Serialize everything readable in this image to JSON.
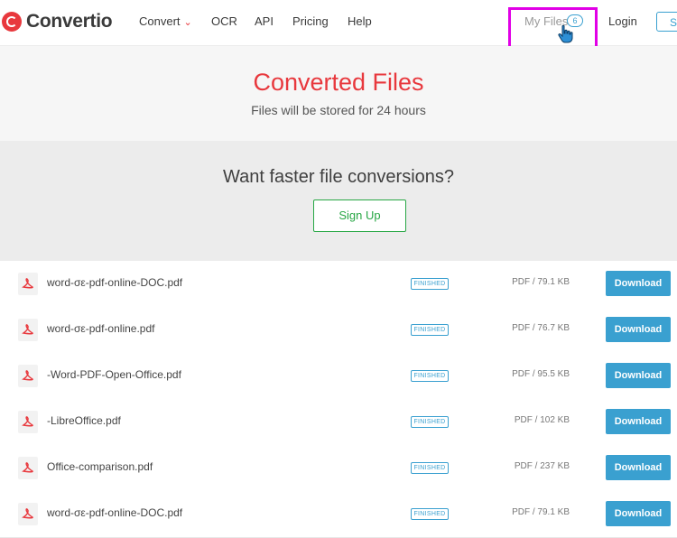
{
  "header": {
    "logo_text": "Convertio",
    "nav": {
      "convert": "Convert",
      "ocr": "OCR",
      "api": "API",
      "pricing": "Pricing",
      "help": "Help",
      "my_files": "My Files",
      "my_files_count": "6",
      "login": "Login",
      "signup": "S"
    }
  },
  "hero": {
    "title": "Converted Files",
    "subtitle": "Files will be stored for 24 hours"
  },
  "promo": {
    "title": "Want faster file conversions?",
    "button": "Sign Up"
  },
  "files": [
    {
      "name": "word-σε-pdf-online-DOC.pdf",
      "status": "FINISHED",
      "meta": "PDF / 79.1 KB",
      "action": "Download"
    },
    {
      "name": "word-σε-pdf-online.pdf",
      "status": "FINISHED",
      "meta": "PDF / 76.7 KB",
      "action": "Download"
    },
    {
      "name": "-Word-PDF-Open-Office.pdf",
      "status": "FINISHED",
      "meta": "PDF / 95.5 KB",
      "action": "Download"
    },
    {
      "name": "-LibreOffice.pdf",
      "status": "FINISHED",
      "meta": "PDF / 102 KB",
      "action": "Download"
    },
    {
      "name": "Office-comparison.pdf",
      "status": "FINISHED",
      "meta": "PDF / 237 KB",
      "action": "Download"
    },
    {
      "name": "word-σε-pdf-online-DOC.pdf",
      "status": "FINISHED",
      "meta": "PDF / 79.1 KB",
      "action": "Download"
    }
  ],
  "colors": {
    "brand_red": "#e8383d",
    "accent_blue": "#3aa0d0",
    "signup_green": "#28a745",
    "highlight_magenta": "#e100e6"
  }
}
